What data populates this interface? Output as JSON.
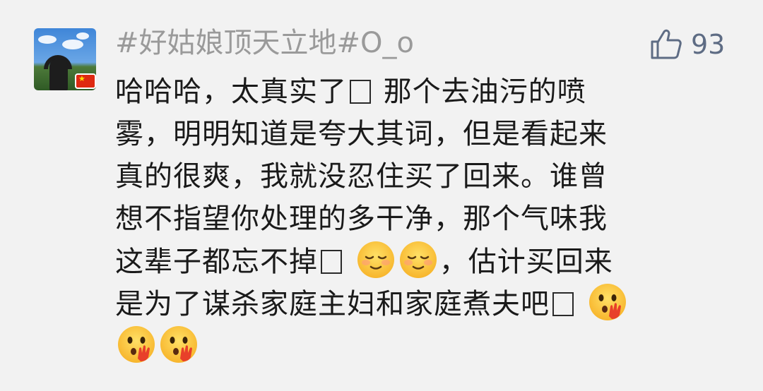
{
  "comment": {
    "username": "#好姑娘顶天立地#O_o",
    "like_count": "93",
    "text_lines": [
      [
        "哈哈哈，太真实了",
        "[box]",
        " 那个去油污的喷"
      ],
      [
        "雾，明明知道是夸大其词，但是看起来"
      ],
      [
        "真的很爽，我就没忍住买了回来。谁曾"
      ],
      [
        "想不指望你处理的多干净，那个气味我"
      ],
      [
        "这辈子都忘不掉",
        "[box]",
        " ",
        "[emoji:relieved]",
        "[emoji:relieved]",
        "，估计买回来"
      ],
      [
        "是为了谋杀家庭主妇和家庭煮夫吧",
        "[box]",
        " ",
        "[emoji:wow-hand]"
      ],
      [
        "[emoji:wow-hand]",
        "[emoji:wow-hand]"
      ]
    ],
    "avatar_badge": "china-flag-icon",
    "like_icon": "thumbs-up-icon"
  },
  "colors": {
    "background": "#f2f2f2",
    "username": "#9a9a9a",
    "text": "#1a1a1a",
    "like": "#5e6c84"
  }
}
